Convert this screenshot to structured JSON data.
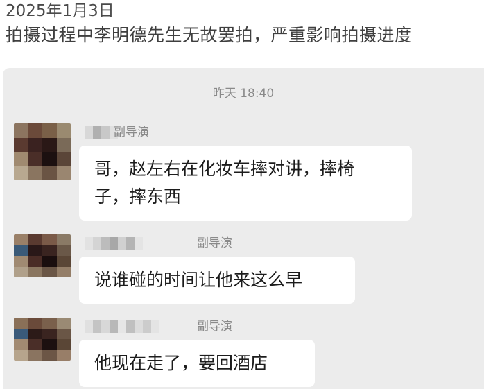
{
  "post": {
    "date": "2025年1月3日",
    "text": "拍摄过程中李明德先生无故罢拍，严重影响拍摄进度"
  },
  "chat": {
    "timestamp": "昨天 18:40",
    "messages": [
      {
        "role": "副导演",
        "lines": [
          "哥，赵左右在化妆车摔对讲，摔椅",
          "子，摔东西"
        ]
      },
      {
        "role": "副导演",
        "lines": [
          "说谁碰的时间让他来这么早"
        ]
      },
      {
        "role": "副导演",
        "lines": [
          "他现在走了，要回酒店"
        ]
      }
    ]
  }
}
